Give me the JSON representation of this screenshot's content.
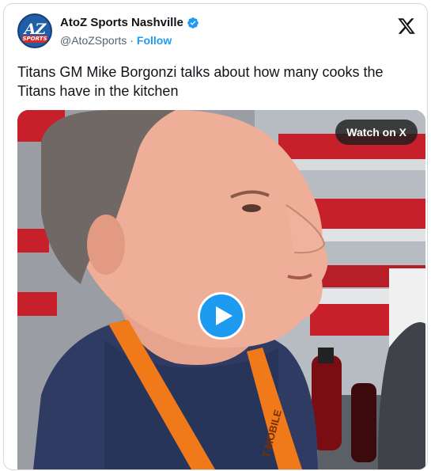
{
  "account": {
    "display_name": "AtoZ Sports Nashville",
    "handle": "@AtoZSports",
    "separator": "·",
    "follow_label": "Follow",
    "avatar_text_main": "AZ",
    "avatar_text_sub": "SPORTS"
  },
  "tweet": {
    "text": "Titans GM Mike Borgonzi talks about how many cooks the Titans have in the kitchen"
  },
  "video": {
    "watch_label": "Watch on X",
    "lanyard_text": "T-MOBILE"
  },
  "colors": {
    "accent": "#1d9bf0",
    "text": "#0f1419",
    "muted": "#536471",
    "border": "#cfd9de",
    "stadium_red": "#c8202b"
  },
  "icons": [
    "verified-badge-icon",
    "x-logo-icon",
    "play-icon"
  ]
}
